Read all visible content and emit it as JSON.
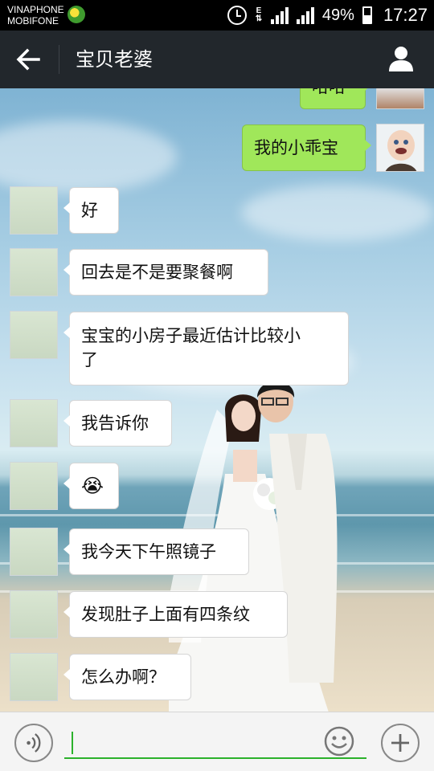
{
  "status_bar": {
    "carrier_1": "VINAPHONE",
    "carrier_2": "MOBIFONE",
    "battery": "49%",
    "time": "17:27",
    "icons": [
      "sim-icon",
      "alarm-icon",
      "network-e-icon",
      "signal-icon",
      "battery-icon"
    ]
  },
  "header": {
    "back_icon": "arrow-left-icon",
    "title": "宝贝老婆",
    "profile_icon": "person-icon"
  },
  "messages": [
    {
      "side": "right",
      "text": "哈哈",
      "partial": true
    },
    {
      "side": "right",
      "text": "我的小乖宝"
    },
    {
      "side": "left",
      "text": "好"
    },
    {
      "side": "left",
      "text": "回去是不是要聚餐啊"
    },
    {
      "side": "left",
      "text_line1": "宝宝的小房子最近估计比较小",
      "text_line2": "了"
    },
    {
      "side": "left",
      "text": "我告诉你"
    },
    {
      "side": "left",
      "emoji": "😭",
      "emoji_name": "crying-emoji"
    },
    {
      "side": "left",
      "text": "我今天下午照镜子"
    },
    {
      "side": "left",
      "text": "发现肚子上面有四条纹"
    },
    {
      "side": "left",
      "text": "怎么办啊？"
    }
  ],
  "input_bar": {
    "voice_icon": "voice-icon",
    "input_value": "",
    "emoji_icon": "smiley-icon",
    "plus_icon": "plus-icon"
  },
  "colors": {
    "header_bg": "#22272c",
    "bubble_sent": "#a0e75a",
    "bubble_received": "#ffffff",
    "accent_green": "#2bb12b"
  }
}
